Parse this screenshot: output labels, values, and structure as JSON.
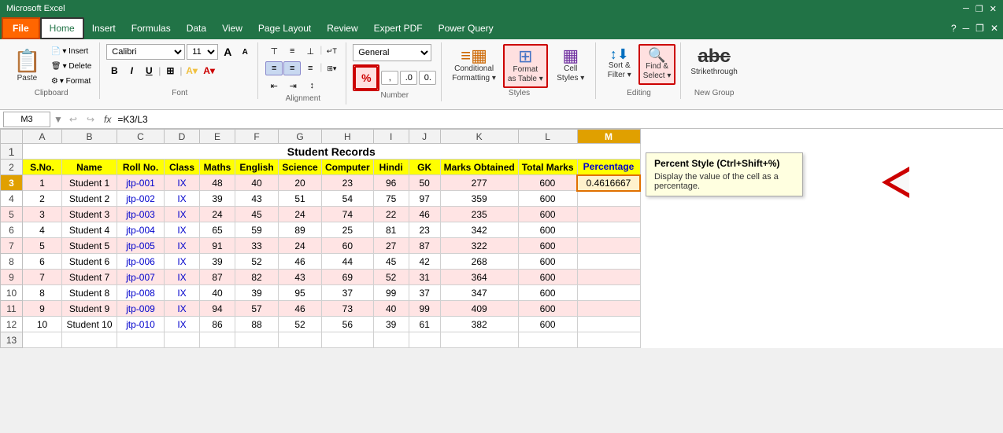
{
  "app": {
    "title": "Microsoft Excel",
    "file_label": "File",
    "tabs": [
      "Home",
      "Insert",
      "Formulas",
      "Data",
      "View",
      "Page Layout",
      "Review",
      "Expert PDF",
      "Power Query"
    ]
  },
  "ribbon": {
    "clipboard": {
      "label": "Clipboard",
      "paste": "Paste",
      "insert": "▾ Insert",
      "delete": "▾ Delete",
      "format": "▾ Format"
    },
    "font": {
      "label": "Font",
      "font_name": "Calibri",
      "font_size": "11",
      "bold": "B",
      "italic": "I",
      "underline": "U"
    },
    "alignment": {
      "label": "Alignment"
    },
    "number": {
      "label": "Number",
      "format": "General",
      "percent_label": "%"
    },
    "styles": {
      "label": "Styles",
      "conditional": "Conditional\nFormatting",
      "format_table": "Format\nas Table",
      "cell_styles": "Cell\nStyles"
    },
    "editing": {
      "label": "Editing",
      "sort_filter": "Sort &\nFilter",
      "find_select": "Find &\nSelect"
    },
    "new_group": {
      "label": "New Group",
      "strikethrough": "Strikethrough"
    }
  },
  "formula_bar": {
    "cell_ref": "M3",
    "fx": "fx",
    "formula": "=K3/L3"
  },
  "tooltip": {
    "title": "Percent Style (Ctrl+Shift+%)",
    "text": "Display the value of the cell as a percentage."
  },
  "spreadsheet": {
    "col_headers": [
      "",
      "A",
      "B",
      "C",
      "D",
      "E",
      "F",
      "G",
      "H",
      "I",
      "J",
      "K",
      "L",
      "M"
    ],
    "title_row": {
      "row_num": "1",
      "content": "Student Records",
      "colspan": 13
    },
    "header_row": {
      "row_num": "2",
      "cells": [
        "S.No.",
        "Name",
        "Roll No.",
        "Class",
        "Maths",
        "English",
        "Science",
        "Computer",
        "Hindi",
        "GK",
        "Marks Obtained",
        "Total Marks",
        "Percentage"
      ]
    },
    "data_rows": [
      {
        "row": "3",
        "color": "pink",
        "cells": [
          "1",
          "Student 1",
          "jtp-001",
          "IX",
          "48",
          "40",
          "20",
          "23",
          "96",
          "50",
          "277",
          "600",
          "0.4616667"
        ]
      },
      {
        "row": "4",
        "color": "white",
        "cells": [
          "2",
          "Student 2",
          "jtp-002",
          "IX",
          "39",
          "43",
          "51",
          "54",
          "75",
          "97",
          "359",
          "600",
          ""
        ]
      },
      {
        "row": "5",
        "color": "pink",
        "cells": [
          "3",
          "Student 3",
          "jtp-003",
          "IX",
          "24",
          "45",
          "24",
          "74",
          "22",
          "46",
          "235",
          "600",
          ""
        ]
      },
      {
        "row": "6",
        "color": "white",
        "cells": [
          "4",
          "Student 4",
          "jtp-004",
          "IX",
          "65",
          "59",
          "89",
          "25",
          "81",
          "23",
          "342",
          "600",
          ""
        ]
      },
      {
        "row": "7",
        "color": "pink",
        "cells": [
          "5",
          "Student 5",
          "jtp-005",
          "IX",
          "91",
          "33",
          "24",
          "60",
          "27",
          "87",
          "322",
          "600",
          ""
        ]
      },
      {
        "row": "8",
        "color": "white",
        "cells": [
          "6",
          "Student 6",
          "jtp-006",
          "IX",
          "39",
          "52",
          "46",
          "44",
          "45",
          "42",
          "268",
          "600",
          ""
        ]
      },
      {
        "row": "9",
        "color": "pink",
        "cells": [
          "7",
          "Student 7",
          "jtp-007",
          "IX",
          "87",
          "82",
          "43",
          "69",
          "52",
          "31",
          "364",
          "600",
          ""
        ]
      },
      {
        "row": "10",
        "color": "white",
        "cells": [
          "8",
          "Student 8",
          "jtp-008",
          "IX",
          "40",
          "39",
          "95",
          "37",
          "99",
          "37",
          "347",
          "600",
          ""
        ]
      },
      {
        "row": "11",
        "color": "pink",
        "cells": [
          "9",
          "Student 9",
          "jtp-009",
          "IX",
          "94",
          "57",
          "46",
          "73",
          "40",
          "99",
          "409",
          "600",
          ""
        ]
      },
      {
        "row": "12",
        "color": "white",
        "cells": [
          "10",
          "Student 10",
          "jtp-010",
          "IX",
          "86",
          "88",
          "52",
          "56",
          "39",
          "61",
          "382",
          "600",
          ""
        ]
      }
    ],
    "empty_row": "13"
  }
}
